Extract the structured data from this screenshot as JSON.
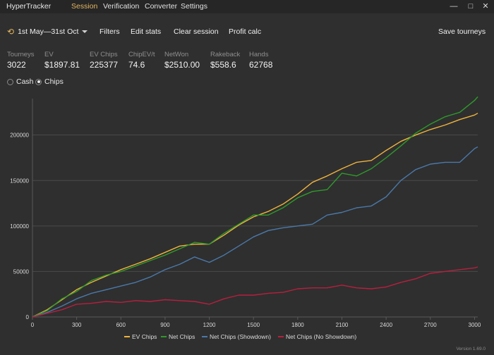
{
  "app": {
    "title": "HyperTracker"
  },
  "nav": {
    "tabs": [
      {
        "label": "Session",
        "active": true
      },
      {
        "label": "Verification",
        "active": false
      },
      {
        "label": "Converter",
        "active": false
      },
      {
        "label": "Settings",
        "active": false
      }
    ]
  },
  "window_controls": {
    "minimize": "—",
    "maximize": "□",
    "close": "✕"
  },
  "toolbar": {
    "date_range": "1st May—31st Oct",
    "filters": "Filters",
    "edit_stats": "Edit stats",
    "clear_session": "Clear session",
    "profit_calc": "Profit calc",
    "save_tourneys": "Save tourneys"
  },
  "stats": [
    {
      "label": "Tourneys",
      "value": "3022"
    },
    {
      "label": "EV",
      "value": "$1897.81"
    },
    {
      "label": "EV Chips",
      "value": "225377"
    },
    {
      "label": "ChipEV/t",
      "value": "74.6"
    },
    {
      "label": "NetWon",
      "value": "$2510.00"
    },
    {
      "label": "Rakeback",
      "value": "$558.6"
    },
    {
      "label": "Hands",
      "value": "62768"
    }
  ],
  "mode": {
    "options": [
      {
        "label": "Cash",
        "selected": false
      },
      {
        "label": "Chips",
        "selected": true
      }
    ]
  },
  "colors": {
    "accent": "#e3b560",
    "ev_chips": "#f0b43c",
    "net_chips": "#2f9a2a",
    "showdown": "#4a79aa",
    "no_showdown": "#b81f3f"
  },
  "version": "Version 1.69.0",
  "chart_data": {
    "type": "line",
    "xlim": [
      0,
      3022
    ],
    "ylim": [
      0,
      240000
    ],
    "x_ticks": [
      "0",
      "300",
      "600",
      "900",
      "1200",
      "1500",
      "1800",
      "2100",
      "2400",
      "2700",
      "3000"
    ],
    "y_ticks": [
      "0",
      "50000",
      "100000",
      "150000",
      "200000"
    ],
    "grid": "horizontal",
    "legend_position": "bottom",
    "series": [
      {
        "name": "EV Chips",
        "color": "#f0b43c",
        "x": [
          0,
          100,
          200,
          300,
          400,
          500,
          600,
          700,
          800,
          900,
          1000,
          1100,
          1200,
          1300,
          1400,
          1500,
          1600,
          1700,
          1800,
          1900,
          2000,
          2100,
          2200,
          2300,
          2400,
          2500,
          2600,
          2700,
          2800,
          2900,
          3000,
          3022
        ],
        "y": [
          0,
          8000,
          19000,
          30000,
          38000,
          45000,
          52000,
          58000,
          64000,
          71000,
          78000,
          80000,
          80000,
          90000,
          101000,
          110000,
          116000,
          124000,
          135000,
          148000,
          155000,
          163000,
          170000,
          172000,
          183000,
          193000,
          200000,
          206000,
          211000,
          217000,
          222000,
          224000
        ]
      },
      {
        "name": "Net Chips",
        "color": "#2f9a2a",
        "x": [
          0,
          100,
          200,
          300,
          400,
          500,
          600,
          700,
          800,
          900,
          1000,
          1100,
          1200,
          1300,
          1400,
          1500,
          1600,
          1700,
          1800,
          1900,
          2000,
          2100,
          2200,
          2300,
          2400,
          2500,
          2600,
          2700,
          2800,
          2900,
          3000,
          3022
        ],
        "y": [
          0,
          7000,
          20000,
          28000,
          40000,
          46000,
          50000,
          56000,
          62000,
          68000,
          75000,
          82000,
          80000,
          92000,
          102000,
          112000,
          112000,
          120000,
          131000,
          138000,
          140000,
          158000,
          155000,
          163000,
          175000,
          188000,
          202000,
          212000,
          220000,
          225000,
          238000,
          242000
        ]
      },
      {
        "name": "Net Chips (Showdown)",
        "color": "#4a79aa",
        "x": [
          0,
          100,
          200,
          300,
          400,
          500,
          600,
          700,
          800,
          900,
          1000,
          1100,
          1200,
          1300,
          1400,
          1500,
          1600,
          1700,
          1800,
          1900,
          2000,
          2100,
          2200,
          2300,
          2400,
          2500,
          2600,
          2700,
          2800,
          2900,
          3000,
          3022
        ],
        "y": [
          0,
          5000,
          12000,
          20000,
          26000,
          30000,
          34000,
          38000,
          44000,
          52000,
          58000,
          66000,
          60000,
          68000,
          78000,
          88000,
          95000,
          98000,
          100000,
          102000,
          112000,
          115000,
          120000,
          122000,
          132000,
          150000,
          162000,
          168000,
          170000,
          170000,
          185000,
          187000
        ]
      },
      {
        "name": "Net Chips (No Showdown)",
        "color": "#b81f3f",
        "x": [
          0,
          100,
          200,
          300,
          400,
          500,
          600,
          700,
          800,
          900,
          1000,
          1100,
          1200,
          1300,
          1400,
          1500,
          1600,
          1700,
          1800,
          1900,
          2000,
          2100,
          2200,
          2300,
          2400,
          2500,
          2600,
          2700,
          2800,
          2900,
          3000,
          3022
        ],
        "y": [
          0,
          4000,
          8000,
          14000,
          15000,
          17000,
          16000,
          18000,
          17000,
          19000,
          18000,
          17000,
          14000,
          20000,
          24000,
          24000,
          26000,
          27000,
          31000,
          32000,
          32000,
          35000,
          32000,
          31000,
          33000,
          38000,
          42000,
          48000,
          50000,
          52000,
          54000,
          55000
        ]
      }
    ]
  }
}
